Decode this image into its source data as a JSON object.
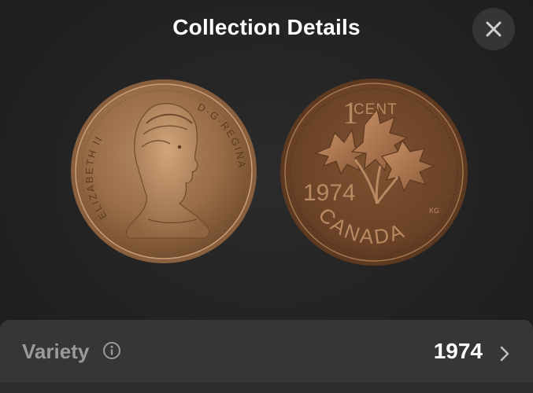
{
  "header": {
    "title": "Collection Details",
    "close_icon": "close-icon"
  },
  "coins": {
    "obverse": {
      "legend_left": "ELIZABETH II",
      "legend_right": "D·G·REGINA"
    },
    "reverse": {
      "denomination_numeral": "1",
      "denomination_text": "CENT",
      "year": "1974",
      "country": "CANADA",
      "designer_initials": "KG"
    }
  },
  "detail_row": {
    "label": "Variety",
    "info_icon": "info-icon",
    "value": "1974",
    "chevron_icon": "chevron-right-icon"
  },
  "colors": {
    "background": "#242323",
    "row_background": "#373636",
    "label_gray": "#9a9a9a",
    "text_white": "#ffffff",
    "copper": "#a9794f"
  }
}
